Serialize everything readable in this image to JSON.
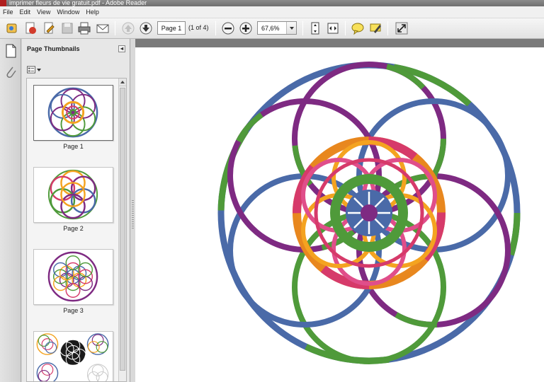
{
  "window": {
    "title": "imprimer fleurs de vie gratuit.pdf - Adobe Reader"
  },
  "menu": [
    "File",
    "Edit",
    "View",
    "Window",
    "Help"
  ],
  "toolbar": {
    "page_value": "Page 1",
    "page_count": "(1 of 4)",
    "zoom_value": "67,6%"
  },
  "panel": {
    "title": "Page Thumbnails",
    "collapse_glyph": "◂",
    "thumbnails": [
      {
        "label": "Page 1",
        "selected": true
      },
      {
        "label": "Page 2",
        "selected": false
      },
      {
        "label": "Page 3",
        "selected": false
      },
      {
        "label": "",
        "selected": false
      }
    ]
  },
  "colors": {
    "blue": "#4a6aa8",
    "purple": "#7e2a82",
    "green": "#4f9a3a",
    "orange": "#f4a320",
    "magenta": "#d63a6a",
    "pink": "#e04e8a"
  }
}
